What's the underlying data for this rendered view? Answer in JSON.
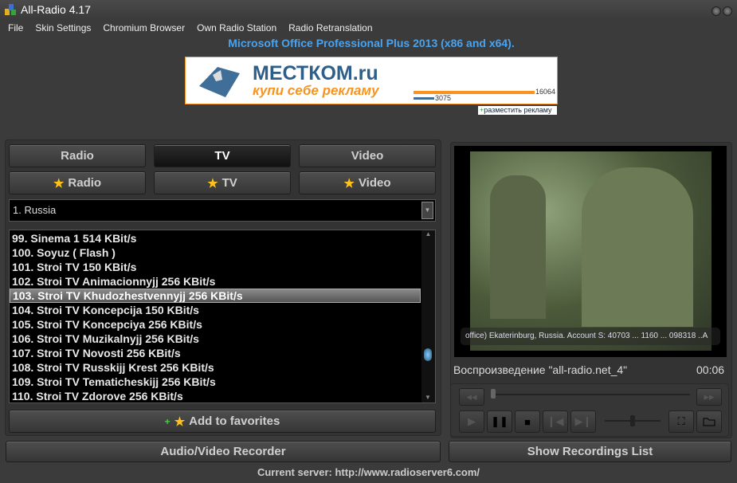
{
  "window": {
    "title": "All-Radio 4.17"
  },
  "menu": [
    "File",
    "Skin Settings",
    "Chromium Browser",
    "Own Radio Station",
    "Radio Retranslation"
  ],
  "ad": {
    "headline": "Microsoft Office Professional Plus 2013 (x86 and x64).",
    "banner_logo": "МЕСТКОМ.ru",
    "banner_slogan": "купи себе рекламу",
    "count_a": "16064",
    "count_b": "3075",
    "place_ad": "разместить рекламу"
  },
  "tabs": [
    "Radio",
    "TV",
    "Video"
  ],
  "fav_tabs": [
    "Radio",
    "TV",
    "Video"
  ],
  "country": "1. Russia",
  "channels": [
    "99. Sinema 1 514 KBit/s",
    "100. Soyuz ( Flash )",
    "101. Stroi TV 150 KBit/s",
    "102. Stroi TV Animacionnyjj 256 KBit/s",
    "103. Stroi TV Khudozhestvennyjj 256 KBit/s",
    "104. Stroi TV Koncepcija 150 KBit/s",
    "105. Stroi TV Koncepciya 256 KBit/s",
    "106. Stroi TV Muzikalnyjj 256 KBit/s",
    "107. Stroi TV Novosti 256 KBit/s",
    "108. Stroi TV Russkijj Krest 256 KBit/s",
    "109. Stroi TV Tematicheskijj 256 KBit/s",
    "110. Stroi TV Zdorove 256 KBit/s"
  ],
  "selected_index": 4,
  "add_favorites": "Add to favorites",
  "recorder": "Audio/Video Recorder",
  "recordings": "Show Recordings List",
  "server": "Current server: http://www.radioserver6.com/",
  "player": {
    "status": "Воспроизведение \"all-radio.net_4\"",
    "time": "00:06",
    "overlay": "office) Ekaterinburg, Russia. Account S: 40703 ... 1160 ... 098318 ..A",
    "progress": 0.0,
    "volume": 0.5
  }
}
